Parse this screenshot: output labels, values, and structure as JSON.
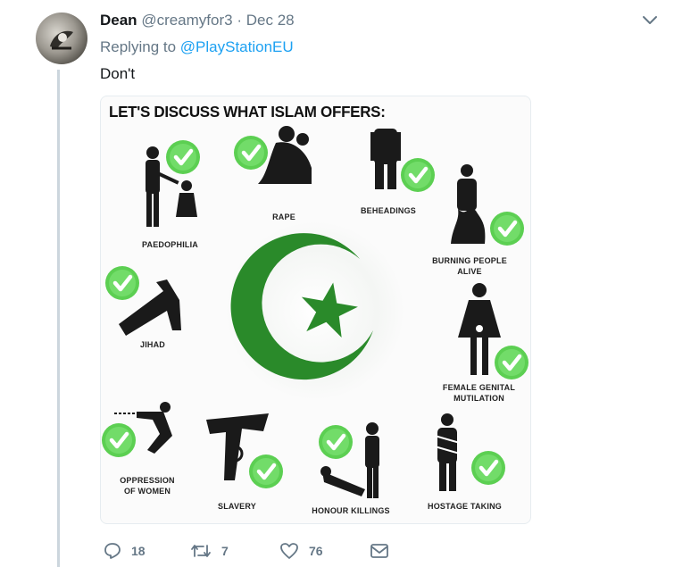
{
  "tweet": {
    "author_name": "Dean",
    "author_handle": "@creamyfor3",
    "date": "Dec 28",
    "reply_prefix": "Replying to",
    "reply_to": "@PlayStationEU",
    "text": "Don't"
  },
  "image": {
    "title": "LET'S DISCUSS WHAT ISLAM OFFERS:",
    "labels": {
      "paedophilia": "PAEDOPHILIA",
      "rape": "RAPE",
      "beheadings": "BEHEADINGS",
      "burning": "BURNING PEOPLE\nALIVE",
      "jihad": "JIHAD",
      "fgm": "FEMALE GENITAL\nMUTILATION",
      "oppression": "OPPRESSION\nOF WOMEN",
      "slavery": "SLAVERY",
      "honour": "HONOUR KILLINGS",
      "hostage": "HOSTAGE TAKING"
    }
  },
  "actions": {
    "replies": "18",
    "retweets": "7",
    "likes": "76"
  },
  "colors": {
    "accent": "#1da1f2",
    "muted": "#657786",
    "check_green": "#5ccf52",
    "symbol_green": "#2a8a2a"
  }
}
